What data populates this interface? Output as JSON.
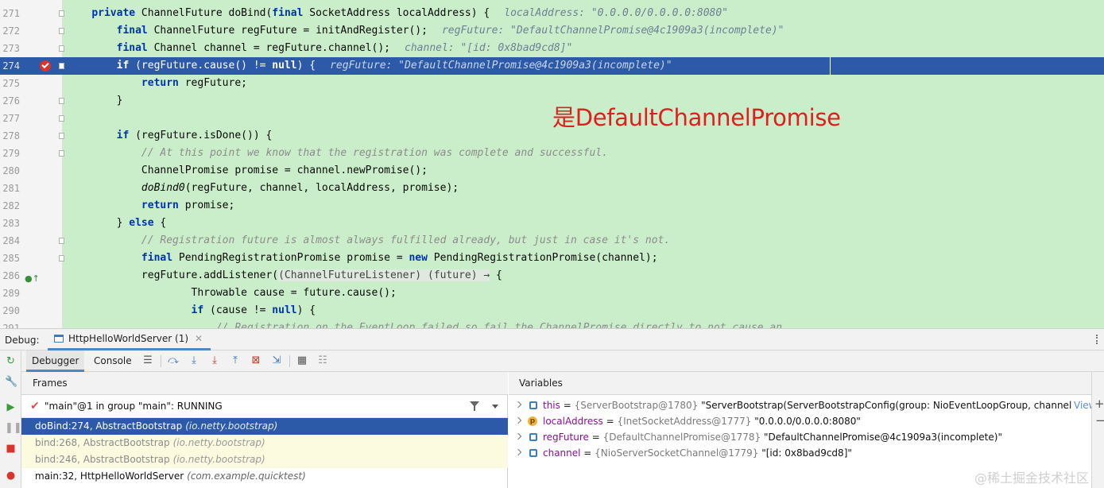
{
  "editor": {
    "annotation": "是DefaultChannelPromise",
    "lines": [
      {
        "num": "271",
        "html": "    <span class=\"kw\">private</span> ChannelFuture doBind(<span class=\"kw\">final</span> SocketAddress localAddress) {<span class=\"hint\">localAddress: \"0.0.0.0/0.0.0.0:8080\"</span>"
      },
      {
        "num": "272",
        "html": "        <span class=\"kw\">final</span> ChannelFuture regFuture = initAndRegister();<span class=\"hint\">regFuture: \"DefaultChannelPromise@4c1909a3(incomplete)\"</span>"
      },
      {
        "num": "273",
        "html": "        <span class=\"kw\">final</span> Channel channel = regFuture.channel();<span class=\"hint\">channel: \"[id: 0x8bad9cd8]\"</span>"
      },
      {
        "num": "274",
        "html": "        <span class=\"kw\">if</span> (regFuture.cause() != <span class=\"kw\">null</span>) {<span class=\"hint\">regFuture: \"DefaultChannelPromise@4c1909a3(incomplete)\"</span>"
      },
      {
        "num": "275",
        "html": "            <span class=\"kw\">return</span> regFuture;"
      },
      {
        "num": "276",
        "html": "        }"
      },
      {
        "num": "277",
        "html": ""
      },
      {
        "num": "278",
        "html": "        <span class=\"kw\">if</span> (regFuture.isDone()) {"
      },
      {
        "num": "279",
        "html": "            <span class=\"cm\">// At this point we know that the registration was complete and successful.</span>"
      },
      {
        "num": "280",
        "html": "            ChannelPromise promise = channel.newPromise();"
      },
      {
        "num": "281",
        "html": "            <span class=\"it\">doBind0</span>(regFuture, channel, localAddress, promise);"
      },
      {
        "num": "282",
        "html": "            <span class=\"kw\">return</span> promise;"
      },
      {
        "num": "283",
        "html": "        } <span class=\"kw\">else</span> {"
      },
      {
        "num": "284",
        "html": "            <span class=\"cm\">// Registration future is almost always fulfilled already, but just in case it's not.</span>"
      },
      {
        "num": "285",
        "html": "            <span class=\"kw\">final</span> PendingRegistrationPromise promise = <span class=\"kw\">new</span> PendingRegistrationPromise(channel);"
      },
      {
        "num": "286",
        "html": "            regFuture.addListener(<span class=\"lam\">(ChannelFutureListener) (future) →</span> {"
      },
      {
        "num": "289",
        "html": "                    Throwable cause = future.cause();"
      },
      {
        "num": "290",
        "html": "                    <span class=\"kw\">if</span> (cause != <span class=\"kw\">null</span>) {"
      },
      {
        "num": "291",
        "html": "                        <span class=\"cm\">// Registration on the EventLoop failed so fail the ChannelPromise directly to not cause an</span>"
      }
    ]
  },
  "debug": {
    "label": "Debug:",
    "session": "HttpHelloWorldServer (1)",
    "tabs": {
      "debugger": "Debugger",
      "console": "Console"
    },
    "frames_title": "Frames",
    "thread": "\"main\"@1 in group \"main\": RUNNING",
    "frames": [
      {
        "method": "doBind:274, AbstractBootstrap",
        "pkg": "(io.netty.bootstrap)",
        "kind": "sel"
      },
      {
        "method": "bind:268, AbstractBootstrap",
        "pkg": "(io.netty.bootstrap)",
        "kind": "lib"
      },
      {
        "method": "bind:246, AbstractBootstrap",
        "pkg": "(io.netty.bootstrap)",
        "kind": "lib"
      },
      {
        "method": "main:32, HttpHelloWorldServer",
        "pkg": "(com.example.quicktest)",
        "kind": "user"
      }
    ],
    "variables_title": "Variables",
    "variables": [
      {
        "name": "this",
        "type": "{ServerBootstrap@1780}",
        "value": "\"ServerBootstrap(ServerBootstrapConfig(group: NioEventLoopGroup, channelFactory: ReflectiveChannelFactory(NioServerSocketChannel.class)\"",
        "icon": "field"
      },
      {
        "name": "localAddress",
        "type": "{InetSocketAddress@1777}",
        "value": "\"0.0.0.0/0.0.0.0:8080\"",
        "icon": "param"
      },
      {
        "name": "regFuture",
        "type": "{DefaultChannelPromise@1778}",
        "value": "\"DefaultChannelPromise@4c1909a3(incomplete)\"",
        "icon": "local"
      },
      {
        "name": "channel",
        "type": "{NioServerSocketChannel@1779}",
        "value": "\"[id: 0x8bad9cd8]\"",
        "icon": "local"
      }
    ],
    "view_link": "View"
  },
  "watermark": "@稀土掘金技术社区",
  "colors": {
    "accent": "#2d5aa8",
    "highlight_bg": "#c9eec9",
    "annotation": "#e01e1e"
  }
}
